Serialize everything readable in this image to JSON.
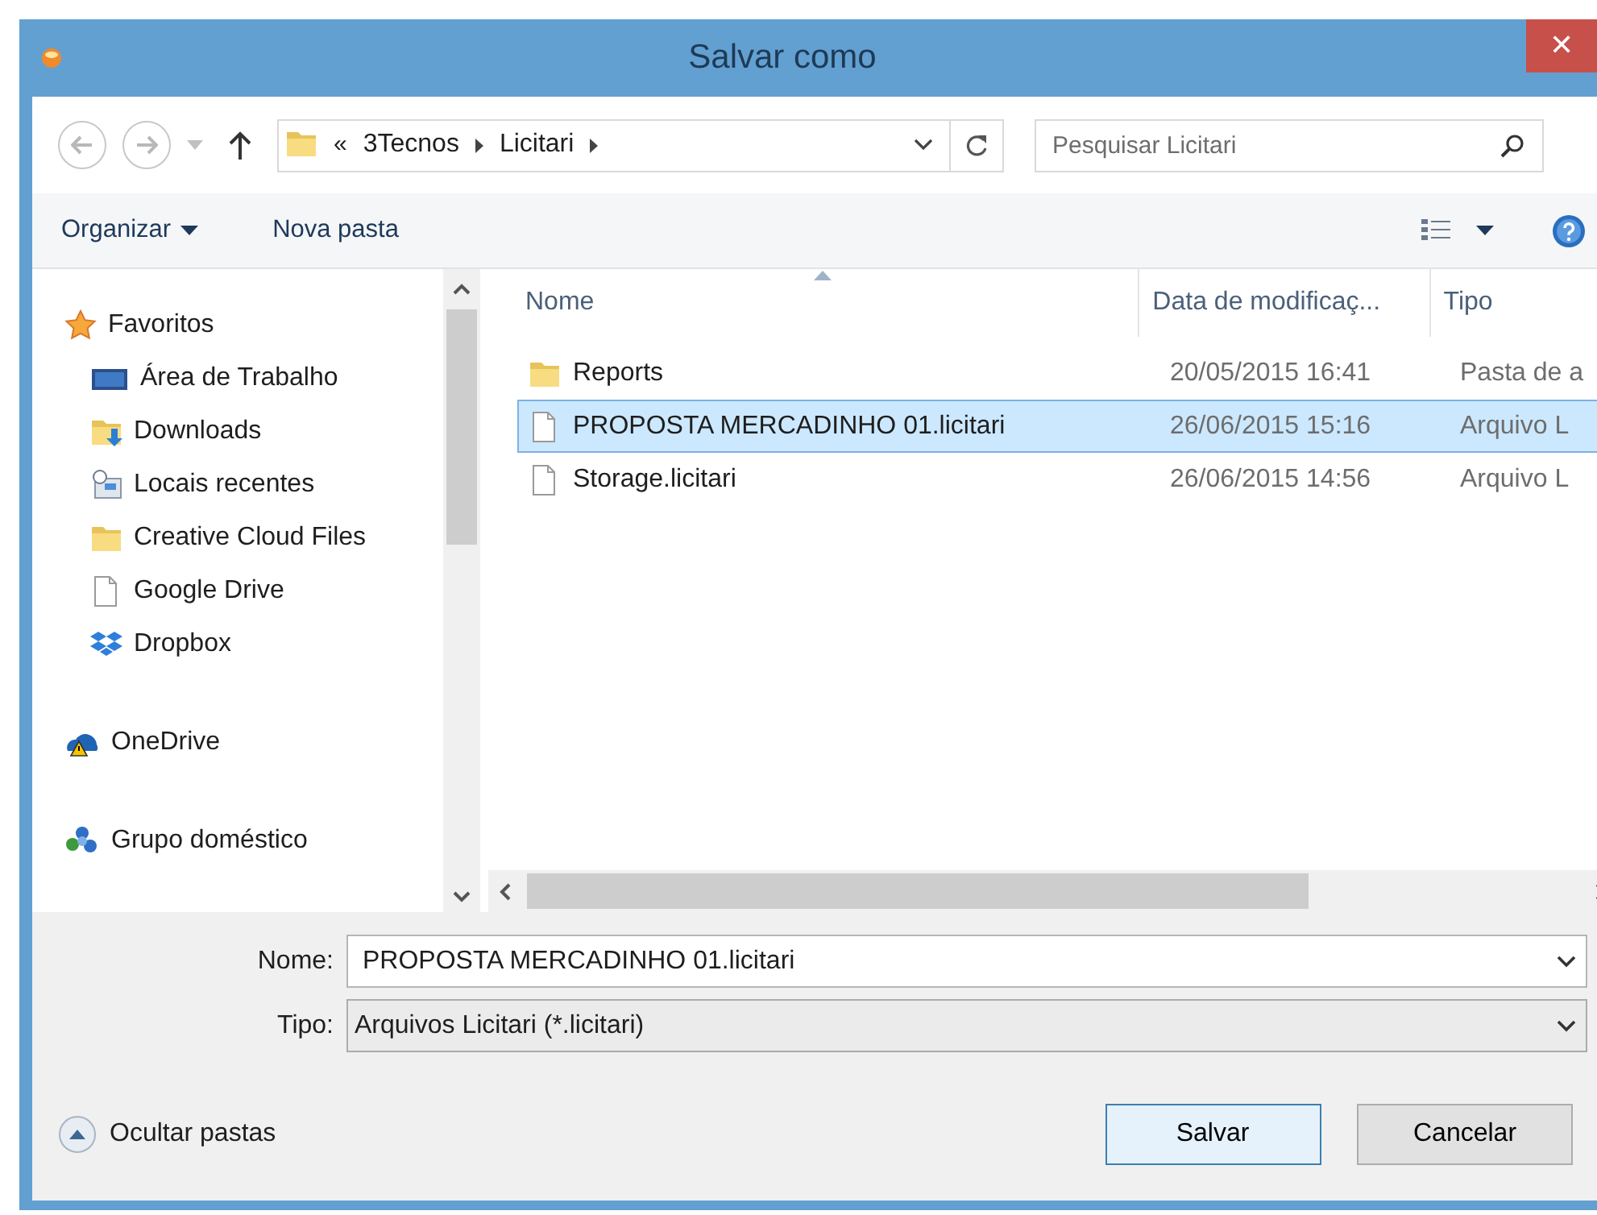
{
  "window": {
    "title": "Salvar como",
    "close": "✕"
  },
  "address": {
    "overflow": "«",
    "crumbs": [
      "3Tecnos",
      "Licitari"
    ]
  },
  "search": {
    "placeholder": "Pesquisar Licitari"
  },
  "toolbar": {
    "organize": "Organizar",
    "new_folder": "Nova pasta"
  },
  "sidebar": {
    "groups": [
      {
        "label": "Favoritos",
        "children": [
          {
            "label": "Área de Trabalho"
          },
          {
            "label": "Downloads"
          },
          {
            "label": "Locais recentes"
          },
          {
            "label": "Creative Cloud Files"
          },
          {
            "label": "Google Drive"
          },
          {
            "label": "Dropbox"
          }
        ]
      },
      {
        "label": "OneDrive"
      },
      {
        "label": "Grupo doméstico"
      }
    ]
  },
  "table": {
    "columns": [
      {
        "label": "Nome",
        "sorted": true
      },
      {
        "label": "Data de modificaç...",
        "sorted": false
      },
      {
        "label": "Tipo",
        "sorted": false
      }
    ],
    "rows": [
      {
        "kind": "folder",
        "name": "Reports",
        "date": "20/05/2015 16:41",
        "type": "Pasta de a",
        "selected": false
      },
      {
        "kind": "file",
        "name": "PROPOSTA MERCADINHO 01.licitari",
        "date": "26/06/2015 15:16",
        "type": "Arquivo L",
        "selected": true
      },
      {
        "kind": "file",
        "name": "Storage.licitari",
        "date": "26/06/2015 14:56",
        "type": "Arquivo L",
        "selected": false
      }
    ]
  },
  "form": {
    "name_label": "Nome:",
    "name_value": "PROPOSTA MERCADINHO 01.licitari",
    "type_label": "Tipo:",
    "type_value": "Arquivos Licitari (*.licitari)"
  },
  "hide_folders": "Ocultar pastas",
  "buttons": [
    {
      "label": "Salvar",
      "default": true
    },
    {
      "label": "Cancelar",
      "default": false
    }
  ]
}
